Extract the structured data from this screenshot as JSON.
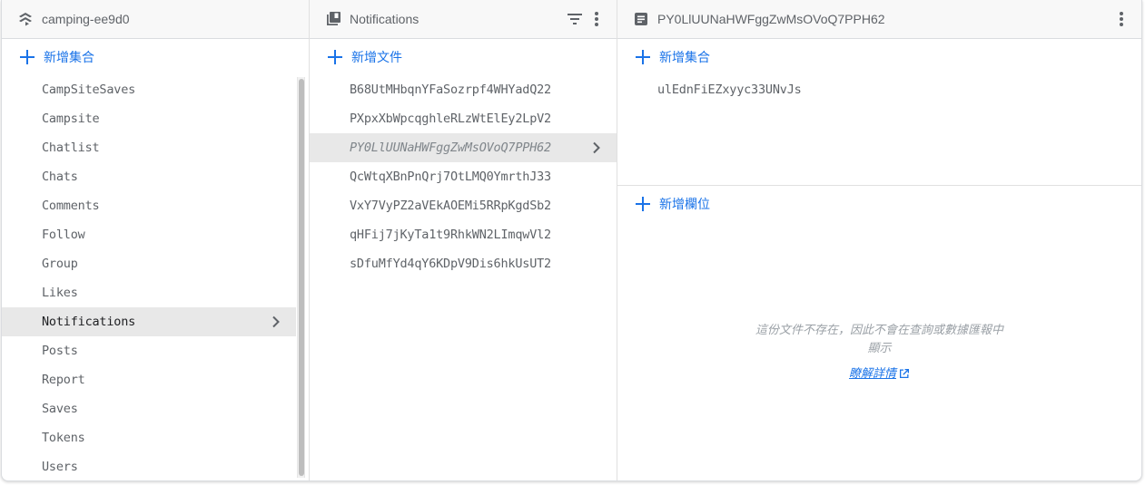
{
  "colors": {
    "accent": "#1a73e8",
    "header_bg": "#f8f8f8",
    "selected_bg": "#e8e8e8",
    "text": "#5f6368"
  },
  "root_panel": {
    "icon": "firestore-layers-icon",
    "title": "camping-ee9d0",
    "add_label": "新增集合",
    "collections": [
      {
        "label": "CampSiteSaves",
        "selected": false
      },
      {
        "label": "Campsite",
        "selected": false
      },
      {
        "label": "Chatlist",
        "selected": false
      },
      {
        "label": "Chats",
        "selected": false
      },
      {
        "label": "Comments",
        "selected": false
      },
      {
        "label": "Follow",
        "selected": false
      },
      {
        "label": "Group",
        "selected": false
      },
      {
        "label": "Likes",
        "selected": false
      },
      {
        "label": "Notifications",
        "selected": true
      },
      {
        "label": "Posts",
        "selected": false
      },
      {
        "label": "Report",
        "selected": false
      },
      {
        "label": "Saves",
        "selected": false
      },
      {
        "label": "Tokens",
        "selected": false
      },
      {
        "label": "Users",
        "selected": false
      }
    ]
  },
  "collection_panel": {
    "icon": "collection-icon",
    "title": "Notifications",
    "filter_icon": "filter-icon",
    "menu_icon": "more-vert-icon",
    "add_label": "新增文件",
    "documents": [
      {
        "label": "B68UtMHbqnYFaSozrpf4WHYadQ22",
        "selected": false
      },
      {
        "label": "PXpxXbWpcqghleRLzWtElEy2LpV2",
        "selected": false
      },
      {
        "label": "PY0LlUUNaHWFggZwMsOVoQ7PPH62",
        "selected": true
      },
      {
        "label": "QcWtqXBnPnQrj7OtLMQ0YmrthJ33",
        "selected": false
      },
      {
        "label": "VxY7VyPZ2aVEkAOEMi5RRpKgdSb2",
        "selected": false
      },
      {
        "label": "qHFij7jKyTa1t9RhkWN2LImqwVl2",
        "selected": false
      },
      {
        "label": "sDfuMfYd4qY6KDpV9Dis6hkUsUT2",
        "selected": false
      }
    ]
  },
  "document_panel": {
    "icon": "document-icon",
    "title": "PY0LlUUNaHWFggZwMsOVoQ7PPH62",
    "menu_icon": "more-vert-icon",
    "add_collection_label": "新增集合",
    "subcollections": [
      "ulEdnFiEZxyyc33UNvJs"
    ],
    "add_field_label": "新增欄位",
    "empty_message": "這份文件不存在，因此不會在查詢或數據匯報中顯示",
    "learn_more_label": "瞭解詳情"
  }
}
